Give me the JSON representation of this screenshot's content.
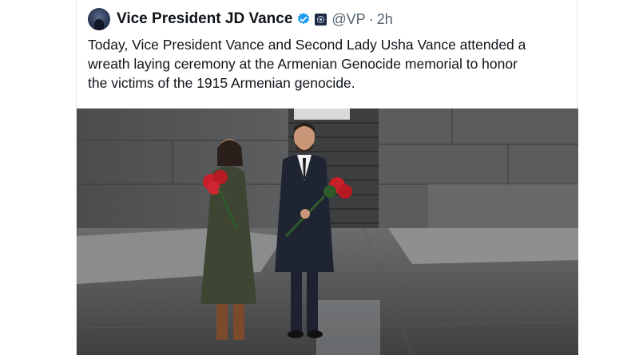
{
  "post": {
    "author_name": "Vice President JD Vance",
    "handle": "@VP",
    "separator": "·",
    "time": "2h",
    "text_lines": [
      "Today, Vice President Vance and Second Lady Usha Vance attended a",
      "wreath laying ceremony at the Armenian Genocide memorial to honor",
      "the victims of the 1915 Armenian genocide."
    ]
  },
  "colors": {
    "verified_badge": "#1d9bf0",
    "text_primary": "#0f1419",
    "text_secondary": "#536471",
    "stone": "#4b4d4f",
    "roses": "#c8202a"
  },
  "icons": {
    "avatar": "profile-photo",
    "verified": "verified-check-icon",
    "affiliation": "government-seal-icon"
  }
}
